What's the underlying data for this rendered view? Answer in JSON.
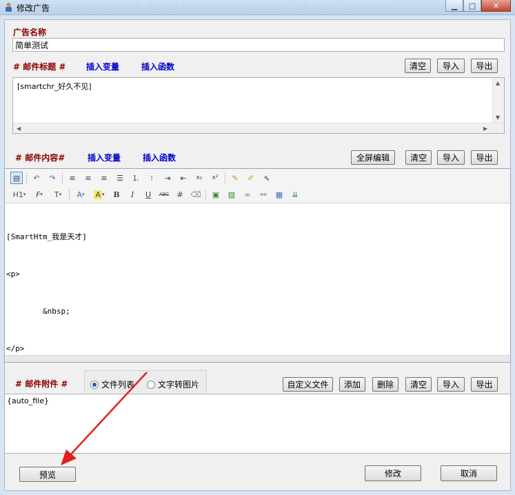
{
  "window": {
    "title": "修改广告",
    "ghost_text": "5F-[fyngt@less] 正在编 - 编辑邮箱 [正在邮件[bt:4C4a]C2017] - 消息 [127] - 邮件数 [192]"
  },
  "ad_name": {
    "label": "广告名称",
    "value": "简单测试"
  },
  "subject": {
    "label": "# 邮件标题 #",
    "insert_var": "插入变量",
    "insert_func": "插入函数",
    "clear": "清空",
    "import": "导入",
    "export": "导出",
    "value": "[smartchr_好久不见]"
  },
  "content": {
    "label": "# 邮件内容#",
    "insert_var": "插入变量",
    "insert_func": "插入函数",
    "fullscreen": "全屏编辑",
    "clear": "清空",
    "import": "导入",
    "export": "导出",
    "lines": [
      "[SmartHtm_我是天才]",
      "<p>",
      "        &nbsp;",
      "</p>"
    ],
    "toolbar_row2": {
      "heading": "H1",
      "font": "F",
      "size": "T",
      "forecolor": "A",
      "backcolor": "A",
      "bold": "B",
      "italic": "I",
      "underline": "U",
      "strike": "ABC"
    }
  },
  "attachment": {
    "label": "# 邮件附件 #",
    "radio_file_list": "文件列表",
    "radio_text_to_image": "文字转图片",
    "custom_file": "自定义文件",
    "add": "添加",
    "delete": "删除",
    "clear": "清空",
    "import": "导入",
    "export": "导出",
    "value": "{auto_file}"
  },
  "footer": {
    "preview": "预览",
    "modify": "修改",
    "cancel": "取消"
  },
  "colors": {
    "label_red": "#8b0000",
    "label_blue": "#0000cc",
    "arrow_red": "#e02020"
  }
}
